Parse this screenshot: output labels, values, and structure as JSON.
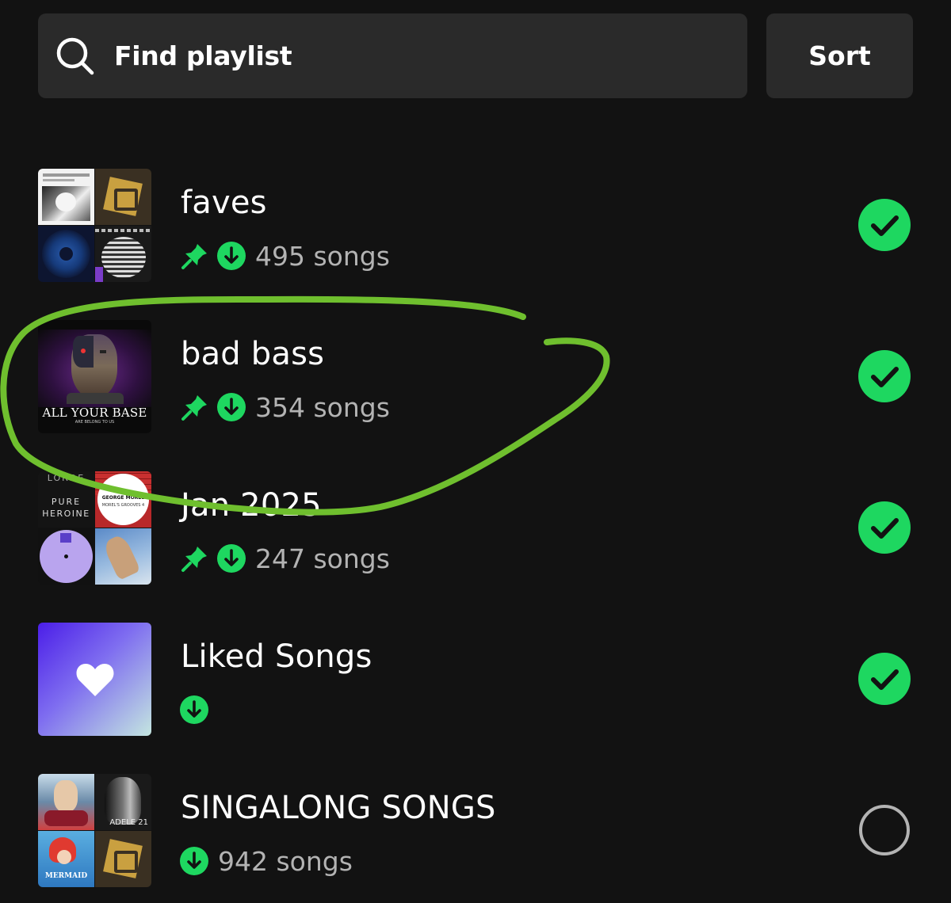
{
  "search": {
    "placeholder": "Find playlist",
    "icon": "search-icon"
  },
  "sort": {
    "label": "Sort"
  },
  "colors": {
    "accent": "#1ed760",
    "background": "#121212",
    "surface": "#2a2a2a",
    "muted": "#b3b3b3",
    "annotation": "#6fbf2e"
  },
  "playlists": [
    {
      "title": "faves",
      "count": "495 songs",
      "pinned": true,
      "downloaded": true,
      "selected": true
    },
    {
      "title": "bad bass",
      "count": "354 songs",
      "pinned": true,
      "downloaded": true,
      "selected": true,
      "cover_text": "ALL YOUR BASE",
      "cover_subtext": "ARE BELONG TO US"
    },
    {
      "title": "Jan 2025",
      "count": "247 songs",
      "pinned": true,
      "downloaded": true,
      "selected": true,
      "cover_text_1": "PURE",
      "cover_text_2": "HEROINE",
      "cover_text_3": "LORDE",
      "cover_text_4": "GEORGE MOREL",
      "cover_text_5": "MOREL'S GROOVES 4"
    },
    {
      "title": "Liked Songs",
      "count": "",
      "pinned": false,
      "downloaded": true,
      "selected": true
    },
    {
      "title": "SINGALONG SONGS",
      "count": "942 songs",
      "pinned": false,
      "downloaded": true,
      "selected": false,
      "cover_text": "ADELE 21",
      "cover_text_2": "MERMAID"
    }
  ]
}
